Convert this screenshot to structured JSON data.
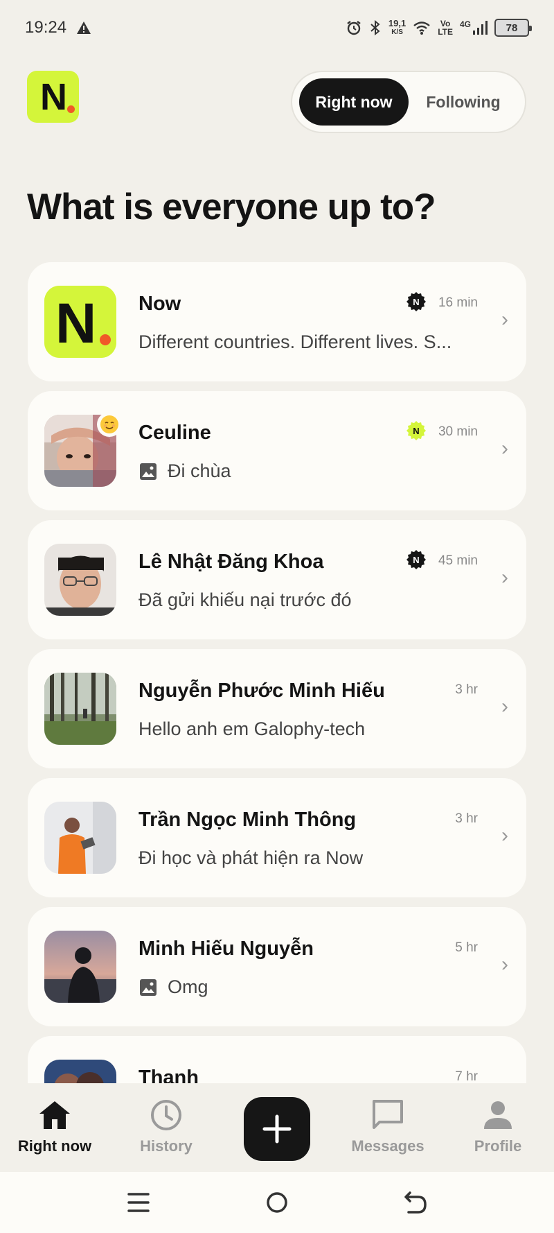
{
  "status_bar": {
    "time": "19:24",
    "net_speed_value": "19,1",
    "net_speed_unit": "K/S",
    "volte_top": "Vo",
    "volte_bottom": "LTE",
    "network": "4G",
    "battery": "78"
  },
  "header": {
    "logo_letter": "N",
    "tabs": [
      {
        "label": "Right now",
        "active": true
      },
      {
        "label": "Following",
        "active": false
      }
    ]
  },
  "page_title": "What is everyone up to?",
  "feed": [
    {
      "name": "Now",
      "subtitle": "Different countries. Different lives. S...",
      "time": "16 min",
      "badge": "dark",
      "has_image_icon": false
    },
    {
      "name": "Ceuline",
      "subtitle": "Đi chùa",
      "time": "30 min",
      "badge": "lime",
      "has_image_icon": true
    },
    {
      "name": "Lê Nhật Đăng Khoa",
      "subtitle": "Đã gửi khiếu nại trước đó",
      "time": "45 min",
      "badge": "dark",
      "has_image_icon": false
    },
    {
      "name": "Nguyễn Phước Minh Hiếu",
      "subtitle": "Hello anh em Galophy-tech",
      "time": "3 hr",
      "badge": "none",
      "has_image_icon": false
    },
    {
      "name": "Trần Ngọc Minh Thông",
      "subtitle": "Đi học và phát hiện ra Now",
      "time": "3 hr",
      "badge": "none",
      "has_image_icon": false
    },
    {
      "name": "Minh Hiếu Nguyễn",
      "subtitle": "Omg",
      "time": "5 hr",
      "badge": "none",
      "has_image_icon": true
    },
    {
      "name": "Thanh",
      "subtitle": "",
      "time": "7 hr",
      "badge": "none",
      "has_image_icon": false
    }
  ],
  "badge_letter": "N",
  "chevron": "›",
  "bottom_nav": {
    "items": [
      {
        "label": "Right now",
        "icon": "home-icon",
        "active": true
      },
      {
        "label": "History",
        "icon": "clock-icon",
        "active": false
      },
      {
        "label": "Messages",
        "icon": "message-icon",
        "active": false
      },
      {
        "label": "Profile",
        "icon": "person-icon",
        "active": false
      }
    ]
  },
  "colors": {
    "background": "#f2f0ea",
    "card": "#fdfcf8",
    "brand_lime": "#d4f53a",
    "brand_orange": "#f05a28",
    "dark": "#161616"
  }
}
